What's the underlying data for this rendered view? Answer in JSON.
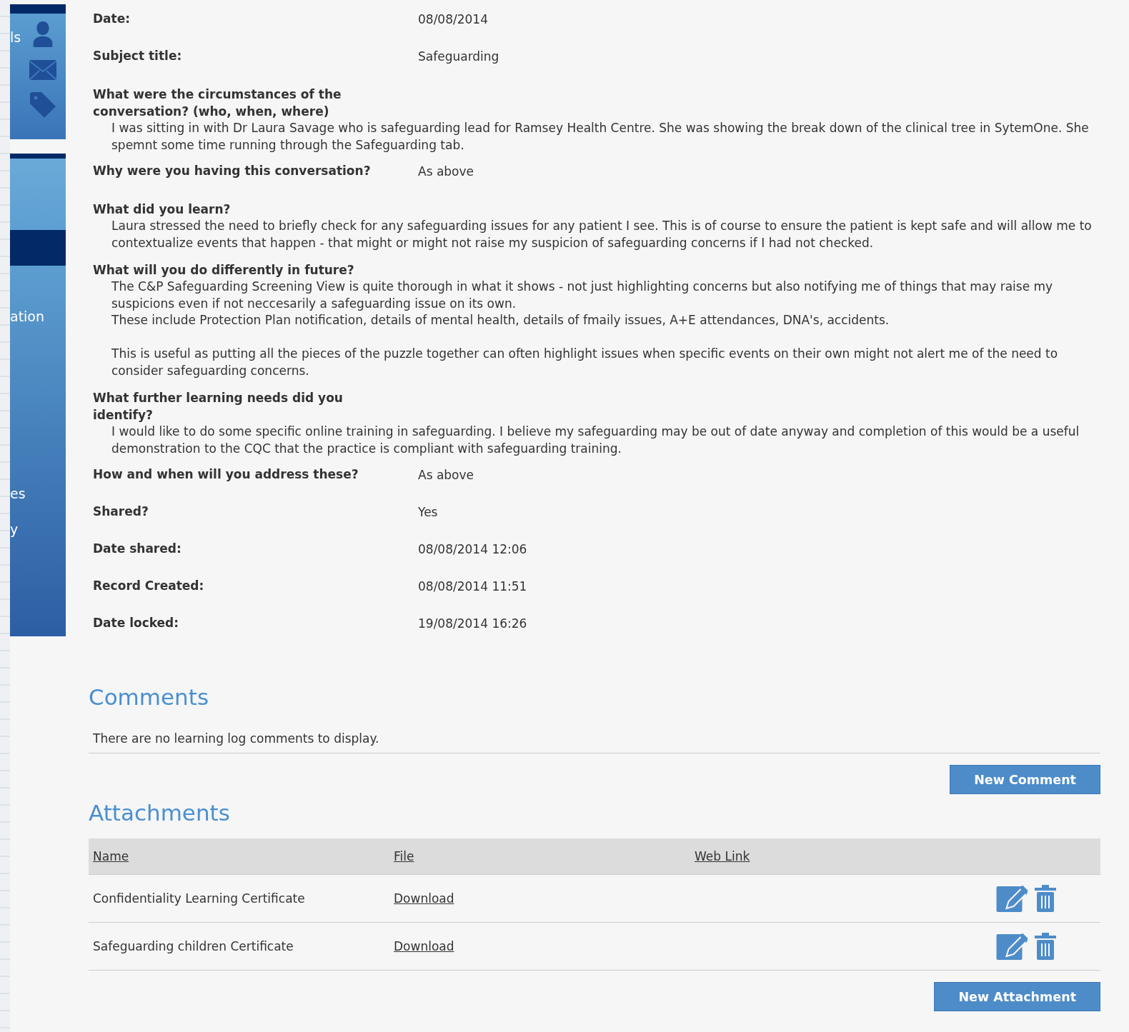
{
  "sidebar": {
    "top_labels": [
      "ls"
    ],
    "bottom_labels": [
      {
        "text": "ation"
      },
      {
        "text": "es"
      },
      {
        "text": "y"
      }
    ]
  },
  "fields": [
    {
      "kind": "inline",
      "label": "Date:",
      "value": "08/08/2014"
    },
    {
      "kind": "inline",
      "label": "Subject title:",
      "value": "Safeguarding"
    },
    {
      "kind": "block",
      "label": "What were the circumstances of the conversation? (who, when, where)",
      "paragraphs": [
        {
          "lines": [
            "I was sitting in with Dr Laura Savage who is safeguarding lead for Ramsey Health Centre. She was showing the break down of the clinical tree in SytemOne. She spemnt some time running through the Safeguarding tab."
          ]
        }
      ]
    },
    {
      "kind": "inline",
      "label": "Why were you having this conversation?",
      "value": "As above"
    },
    {
      "kind": "block",
      "label": "What did you learn?",
      "paragraphs": [
        {
          "lines": [
            "Laura stressed the need to briefly check for any safeguarding issues for any patient I see. This is of course to ensure the patient is kept safe and will allow me to contextualize events that happen - that might or might not raise my suspicion of safeguarding concerns if I had not checked."
          ]
        }
      ]
    },
    {
      "kind": "block",
      "label": "What will you do differently in future?",
      "paragraphs": [
        {
          "lines": [
            "The C&P Safeguarding Screening View is quite thorough in what it shows - not just highlighting concerns but also notifying me of things that may raise my suspicions even if not neccesarily a safeguarding issue on its own.",
            "These include Protection Plan notification, details of mental health, details of fmaily issues, A+E attendances, DNA's, accidents."
          ]
        },
        {
          "lines": [
            "This is useful as putting all the pieces of the puzzle together can often highlight issues when specific events on their own might not alert me of the need to consider safeguarding concerns."
          ]
        }
      ]
    },
    {
      "kind": "block",
      "label": "What further learning needs did you identify?",
      "paragraphs": [
        {
          "lines": [
            "I would like to do some specific online training in safeguarding. I believe my safeguarding may be out of date anyway and completion of this would be a useful demonstration to the CQC that the practice is compliant with safeguarding training."
          ]
        }
      ]
    },
    {
      "kind": "inline",
      "label": "How and when will you address these?",
      "value": "As above"
    },
    {
      "kind": "inline",
      "label": "Shared?",
      "value": "Yes"
    },
    {
      "kind": "inline",
      "label": "Date shared:",
      "value": "08/08/2014 12:06"
    },
    {
      "kind": "inline",
      "label": "Record Created:",
      "value": "08/08/2014 11:51"
    },
    {
      "kind": "inline",
      "label": "Date locked:",
      "value": "19/08/2014 16:26"
    }
  ],
  "comments": {
    "title": "Comments",
    "empty_message": "There are no learning log comments to display.",
    "button": "New Comment"
  },
  "attachments": {
    "title": "Attachments",
    "columns": [
      "Name",
      "File",
      "Web Link"
    ],
    "rows": [
      {
        "name": "Confidentiality Learning Certificate",
        "file": "Download"
      },
      {
        "name": "Safeguarding children Certificate",
        "file": "Download"
      }
    ],
    "button": "New Attachment"
  }
}
